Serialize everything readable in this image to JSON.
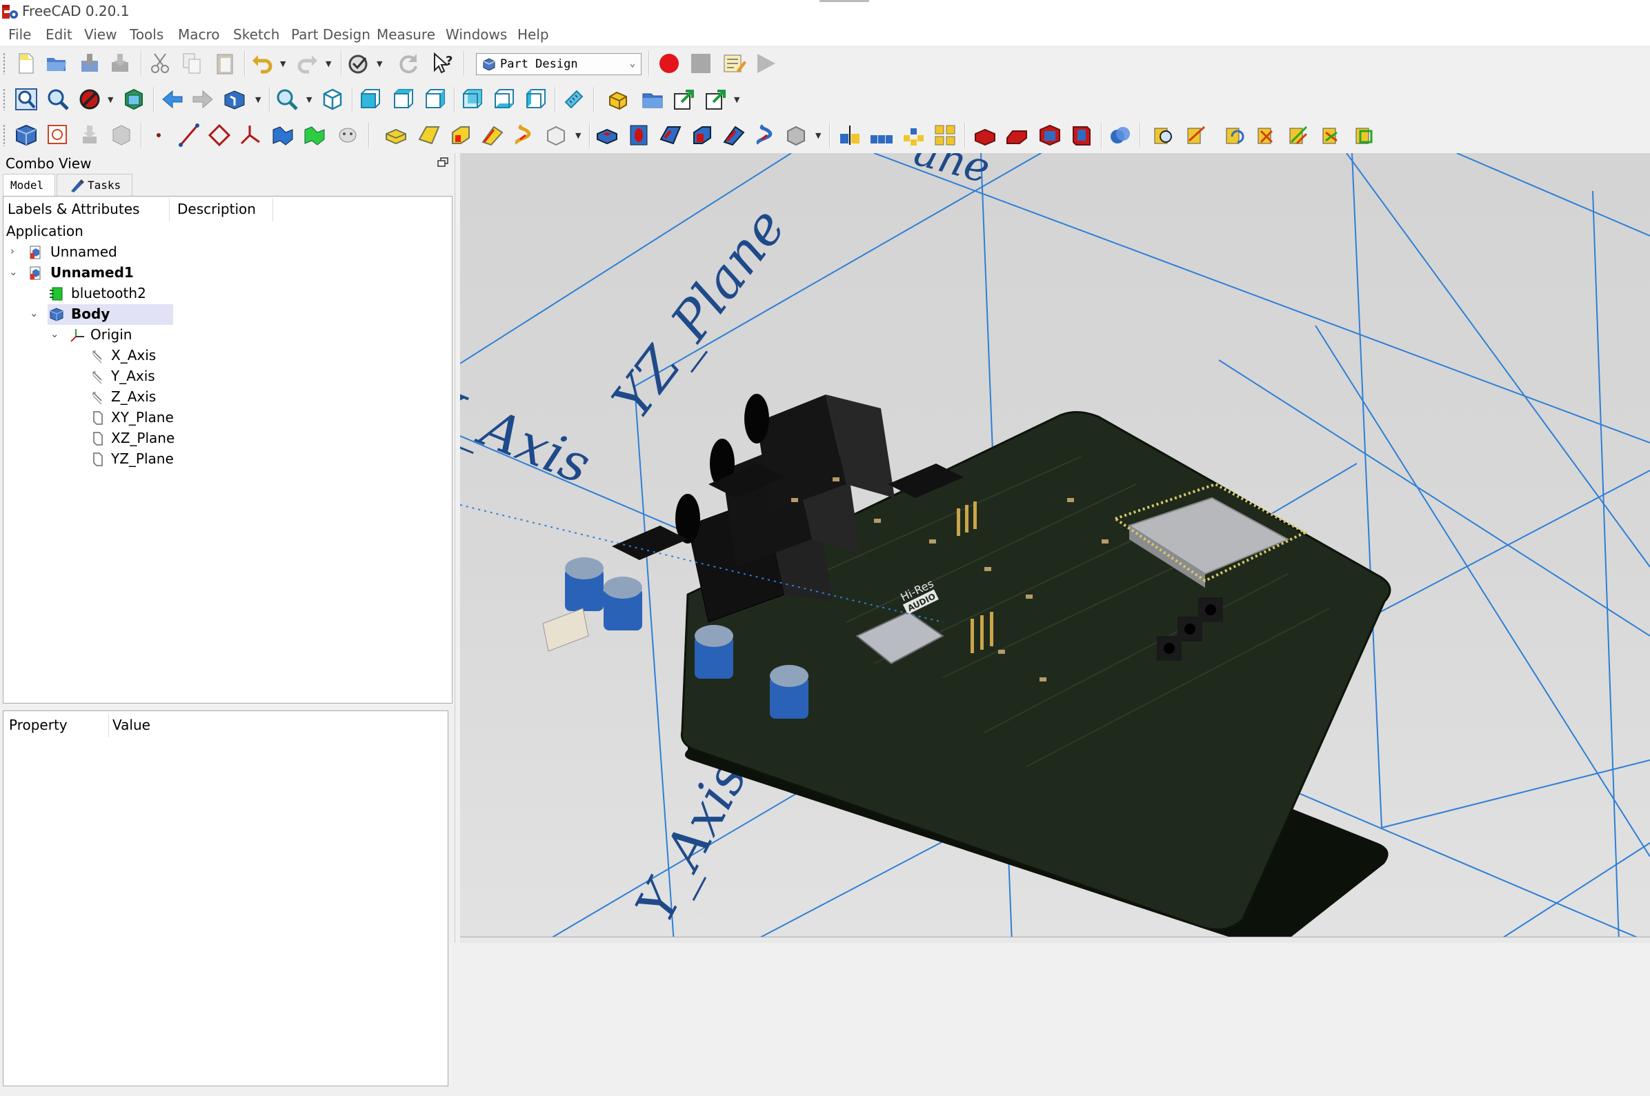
{
  "window": {
    "title": "FreeCAD 0.20.1"
  },
  "menu": [
    "File",
    "Edit",
    "View",
    "Tools",
    "Macro",
    "Sketch",
    "Part Design",
    "Measure",
    "Windows",
    "Help"
  ],
  "workbench_selector": {
    "value": "Part Design"
  },
  "combo_view": {
    "title": "Combo View",
    "tabs": {
      "model": "Model",
      "tasks": "Tasks"
    },
    "tree": {
      "columns": {
        "labels": "Labels & Attributes",
        "description": "Description"
      },
      "root": "Application",
      "items": {
        "unnamed": "Unnamed",
        "unnamed1": "Unnamed1",
        "bluetooth2": "bluetooth2",
        "body": "Body",
        "origin": "Origin",
        "x_axis": "X_Axis",
        "y_axis": "Y_Axis",
        "z_axis": "Z_Axis",
        "xy_plane": "XY_Plane",
        "xz_plane": "XZ_Plane",
        "yz_plane": "YZ_Plane"
      }
    },
    "property_panel": {
      "property": "Property",
      "value": "Value"
    }
  },
  "view3d": {
    "labels": {
      "yz_plane": "YZ_Plane",
      "x_axis": "X_Axis",
      "y_axis": "Y_Axis",
      "plane_top": "ane"
    },
    "pcb_silkscreen": {
      "hires": "Hi-Res",
      "audio": "AUDIO"
    },
    "colors": {
      "axis_lines": "#2e7fd6",
      "label": "#1f4a8a",
      "pcb": "#1f2a1c",
      "capacitor": "#2a62b8"
    }
  },
  "toolbar_icons": [
    "new-icon",
    "open-icon",
    "save-icon",
    "save-as-icon",
    "cut-icon",
    "copy-icon",
    "paste-icon",
    "undo-icon",
    "redo-icon",
    "refresh-icon",
    "whats-this-icon",
    "record-macro-icon",
    "stop-macro-icon",
    "edit-macro-icon",
    "run-macro-icon"
  ]
}
